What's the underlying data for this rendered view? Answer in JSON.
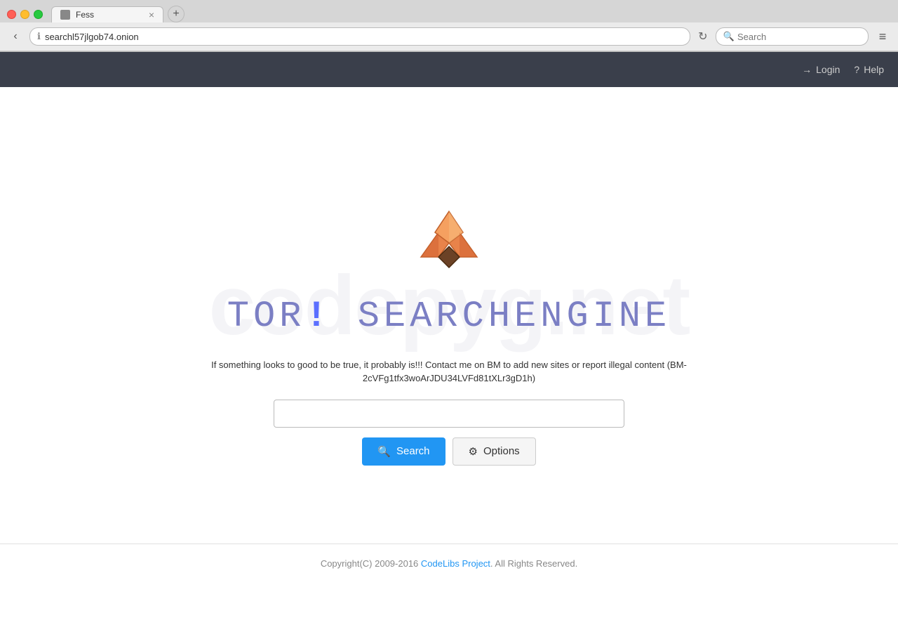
{
  "browser": {
    "tab_title": "Fess",
    "tab_close_label": "×",
    "new_tab_label": "+",
    "address": "searchl57jlgob74.onion",
    "reload_label": "↻",
    "search_placeholder": "Search",
    "menu_label": "≡",
    "back_label": "‹",
    "info_label": "ℹ"
  },
  "header": {
    "login_label": "Login",
    "help_label": "Help"
  },
  "watermark": {
    "text": "codepyg.net"
  },
  "hero": {
    "title_part1": "Tor",
    "title_exclamation": "!",
    "title_part2": "SearchEngine",
    "disclaimer": "If something looks to good to be true, it probably is!!! Contact me on BM to add new sites or report illegal content (BM-2cVFg1tfx3woArJDU34LVFd81tXLr3gD1h)",
    "search_placeholder": "",
    "search_button_label": "Search",
    "options_button_label": "Options"
  },
  "footer": {
    "copyright_text": "Copyright(C) 2009-2016",
    "link_text": "CodeLibs Project",
    "rights_text": ". All Rights Reserved."
  }
}
